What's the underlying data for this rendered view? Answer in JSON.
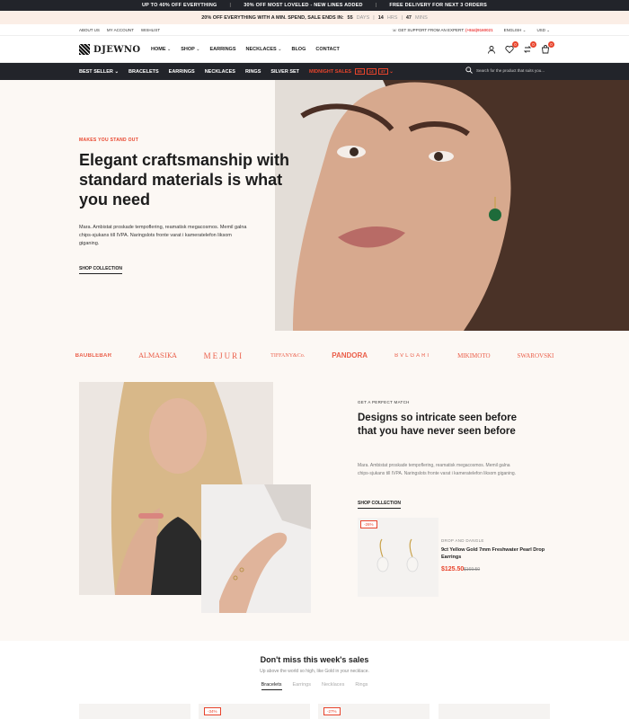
{
  "announcement": {
    "items": [
      "UP TO 40% OFF EVERYTHING",
      "30% OFF MOST LOVELED - NEW LINES ADDED",
      "FREE DELIVERY FOR NEXT 3 ORDERS"
    ],
    "sep": "|"
  },
  "promo": {
    "text": "20% OFF EVERYTHING WITH A MIN. SPEND, SALE ENDS IN:",
    "days": "55",
    "days_label": "DAYS",
    "hrs": "14",
    "hrs_label": "HRS",
    "mins": "47",
    "mins_label": "MINS"
  },
  "util": {
    "links": [
      "ABOUT US",
      "MY ACCOUNT",
      "WISHLIST"
    ],
    "support_label": "GET SUPPORT FROM AN EXPERT:",
    "support_phone": "(+844)9160021",
    "language": "ENGLISH",
    "currency": "USD"
  },
  "header": {
    "logo": "DJEWNO",
    "nav": [
      {
        "label": "HOME",
        "dropdown": true
      },
      {
        "label": "SHOP",
        "dropdown": true
      },
      {
        "label": "EARRINGS",
        "dropdown": false
      },
      {
        "label": "NECKLACES",
        "dropdown": true
      },
      {
        "label": "BLOG",
        "dropdown": false
      },
      {
        "label": "CONTACT",
        "dropdown": false
      }
    ],
    "wishlist_count": "0",
    "compare_count": "0",
    "cart_count": "0"
  },
  "catbar": {
    "items": [
      "BEST SELLER",
      "BRACELETS",
      "EARRINGS",
      "NECKLACES",
      "RINGS",
      "SILVER SET"
    ],
    "midnight": "MIDNIGHT SALES",
    "cd": [
      "55",
      "14",
      "47"
    ],
    "search_placeholder": "Search for the product that suits you..."
  },
  "hero": {
    "eyebrow": "MAKES YOU STAND OUT",
    "title": "Elegant craftsmanship with standard materials is what you need",
    "desc": "Mara. Ambistat proskade tempoflering, reamatisk megacosmos. Memil galna chips-sjukans till IVPA. Naringslots fronte varat i kameratelefon liksom giganing.",
    "cta": "SHOP COLLECTION"
  },
  "brands": [
    "BAUBLEBAR",
    "ALMASIKA",
    "MEJURI",
    "TIFFANY&Co.",
    "PANDORA",
    "BVLGARI",
    "MIKIMOTO",
    "SWAROVSKI"
  ],
  "feature": {
    "eyebrow": "GET A PERFECT MATCH",
    "title": "Designs so intricate seen before that you have never seen before",
    "desc": "Mara. Ambistat proskade tempoflering, reamatisk megacosmos. Memil galna chips-sjukans till IVPA. Naringslots fronte varat i kameratelefon liksom giganing.",
    "cta": "SHOP COLLECTION",
    "product": {
      "tag": "-26%",
      "category": "DROP AND DANGLE",
      "name": "9ct Yellow Gold 7mm Freshwater Pearl Drop Earrings",
      "price": "$125.50",
      "old_price": "$169.50"
    }
  },
  "sales": {
    "title": "Don't miss this week's sales",
    "subtitle": "Up above the world so high, like Gold in your necklace.",
    "tabs": [
      "Bracelets",
      "Earrings",
      "Necklaces",
      "Rings"
    ],
    "card_tags": [
      "-34%",
      "-27%"
    ]
  }
}
